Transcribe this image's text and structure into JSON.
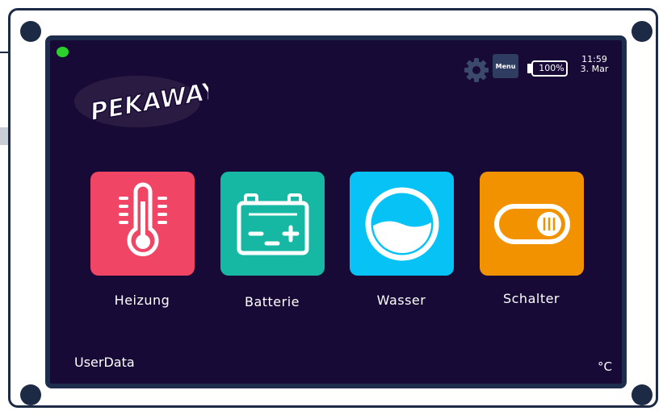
{
  "device": {
    "brand_logo_text": "PEKAWAY",
    "status_led_color": "#2bd12b"
  },
  "header": {
    "settings_icon": "gear-icon",
    "menu_label": "Menu",
    "battery_percent": "100%",
    "time": "11:59",
    "date": "3. Mar"
  },
  "tiles": [
    {
      "label": "Heizung",
      "icon": "thermometer-icon",
      "color": "#f04565"
    },
    {
      "label": "Batterie",
      "icon": "car-battery-icon",
      "color": "#16b8a4"
    },
    {
      "label": "Wasser",
      "icon": "water-tank-icon",
      "color": "#07c2f4"
    },
    {
      "label": "Schalter",
      "icon": "toggle-switch-icon",
      "color": "#f39200"
    }
  ],
  "footer": {
    "userdata_label": "UserData",
    "temperature_unit": "°C"
  }
}
